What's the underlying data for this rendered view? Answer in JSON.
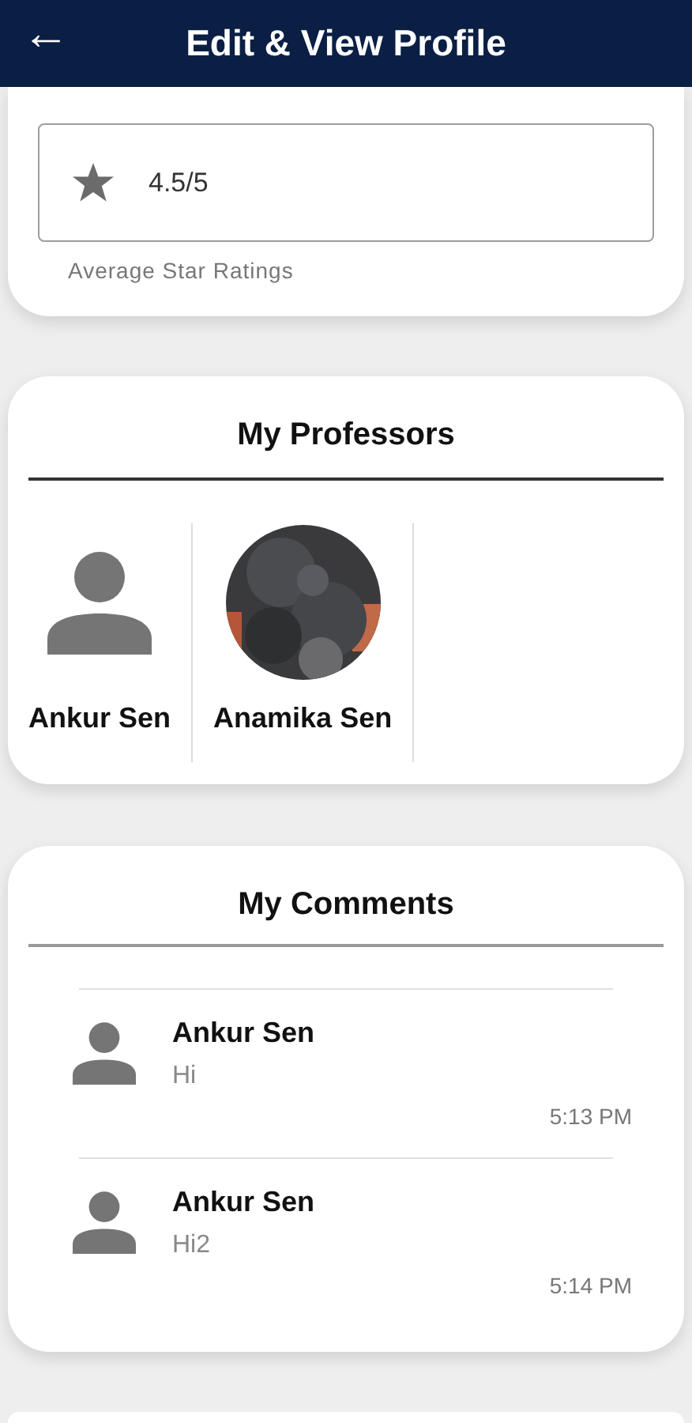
{
  "header": {
    "back_icon": "←",
    "title": "Edit & View Profile"
  },
  "rating": {
    "value": "4.5/5",
    "caption": "Average Star Ratings"
  },
  "professors": {
    "title": "My Professors",
    "items": [
      {
        "name": "Ankur Sen",
        "kind": "avatar"
      },
      {
        "name": "Anamika Sen",
        "kind": "picture"
      }
    ]
  },
  "comments": {
    "title": "My Comments",
    "items": [
      {
        "name": "Ankur Sen",
        "text": "Hi",
        "time": "5:13 PM"
      },
      {
        "name": "Ankur Sen",
        "text": "Hi2",
        "time": "5:14 PM"
      }
    ]
  }
}
